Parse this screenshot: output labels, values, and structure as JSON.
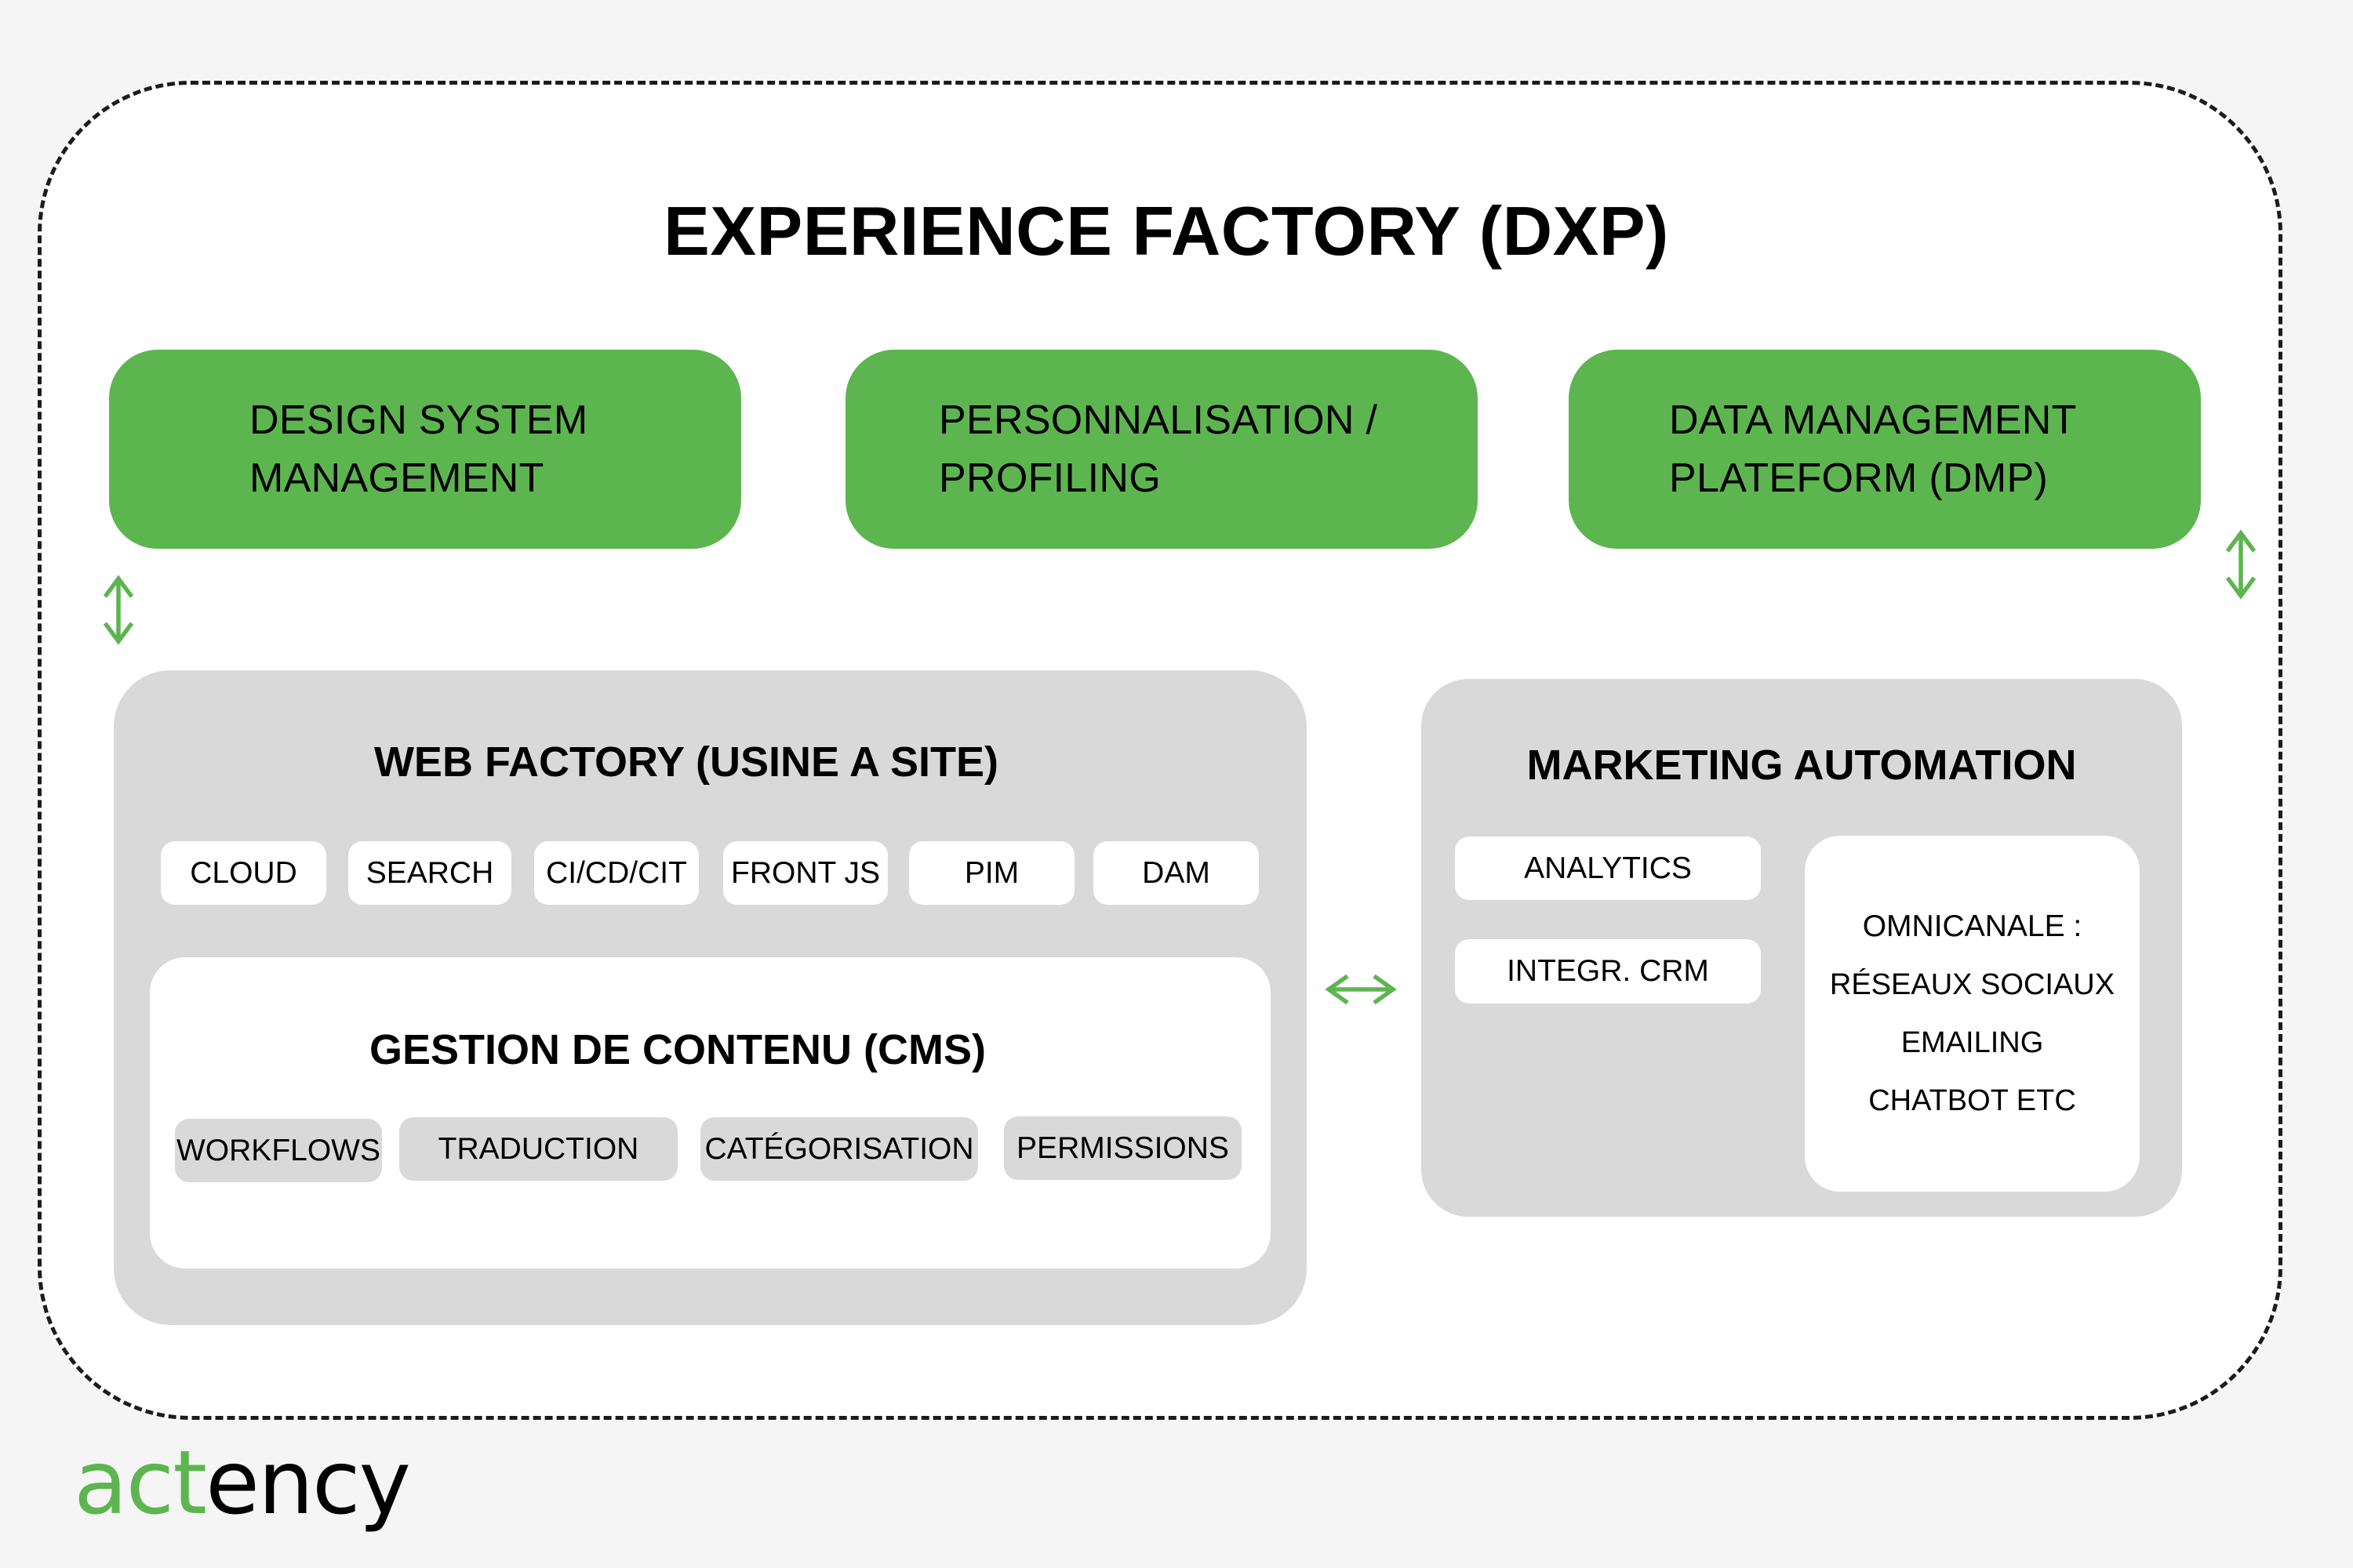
{
  "title": "EXPERIENCE FACTORY (DXP)",
  "colors": {
    "accent_green": "#5db54f",
    "panel_gray": "#d9d9d9",
    "page_background": "#f5f5f5",
    "frame_dash": "#1c1c1c"
  },
  "top_modules": [
    {
      "lines": [
        "DESIGN SYSTEM",
        "MANAGEMENT"
      ]
    },
    {
      "lines": [
        "PERSONNALISATION /",
        "PROFILING"
      ]
    },
    {
      "lines": [
        "DATA MANAGEMENT",
        "PLATEFORM (DMP)"
      ]
    }
  ],
  "web_factory": {
    "title": "WEB FACTORY (USINE A SITE)",
    "components": [
      "CLOUD",
      "SEARCH",
      "CI/CD/CIT",
      "FRONT JS",
      "PIM",
      "DAM"
    ],
    "cms": {
      "title": "GESTION DE CONTENU (CMS)",
      "features": [
        "WORKFLOWS",
        "TRADUCTION",
        "CATÉGORISATION",
        "PERMISSIONS"
      ]
    }
  },
  "marketing_automation": {
    "title": "MARKETING AUTOMATION",
    "components": [
      "ANALYTICS",
      "INTEGR. CRM"
    ],
    "omnichannel": {
      "heading": "OMNICANALE :",
      "items": [
        "RÉSEAUX SOCIAUX",
        "EMAILING",
        "CHATBOT ETC"
      ]
    }
  },
  "connectors": [
    {
      "icon": "double-arrow-vertical-icon",
      "between": [
        "Design System Management",
        "Web Factory"
      ]
    },
    {
      "icon": "double-arrow-horizontal-icon",
      "between": [
        "Web Factory",
        "Marketing Automation"
      ]
    },
    {
      "icon": "double-arrow-vertical-icon",
      "between": [
        "Data Management Plateform (DMP)",
        "Marketing Automation"
      ]
    }
  ],
  "logo": {
    "green_part": "act",
    "black_part": "ency"
  }
}
